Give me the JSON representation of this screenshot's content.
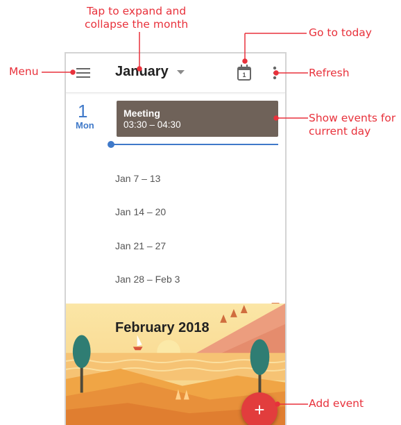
{
  "callouts": {
    "expand_month": "Tap to expand and\ncollapse the month",
    "go_to_today": "Go to today",
    "menu": "Menu",
    "refresh": "Refresh",
    "show_events": "Show events for\ncurrent day",
    "add_event": "Add event"
  },
  "appbar": {
    "month": "January",
    "today_icon_day": "1"
  },
  "day": {
    "number": "1",
    "name": "Mon"
  },
  "event": {
    "title": "Meeting",
    "time": "03:30 – 04:30"
  },
  "weeks": [
    "Jan 7 – 13",
    "Jan 14 – 20",
    "Jan 21 – 27",
    "Jan 28 – Feb 3"
  ],
  "next_month": "February 2018",
  "fab_label": "+",
  "colors": {
    "accent": "#3f79c9",
    "callout": "#e8313b",
    "event": "#6f6259",
    "fab": "#e23d3d"
  }
}
